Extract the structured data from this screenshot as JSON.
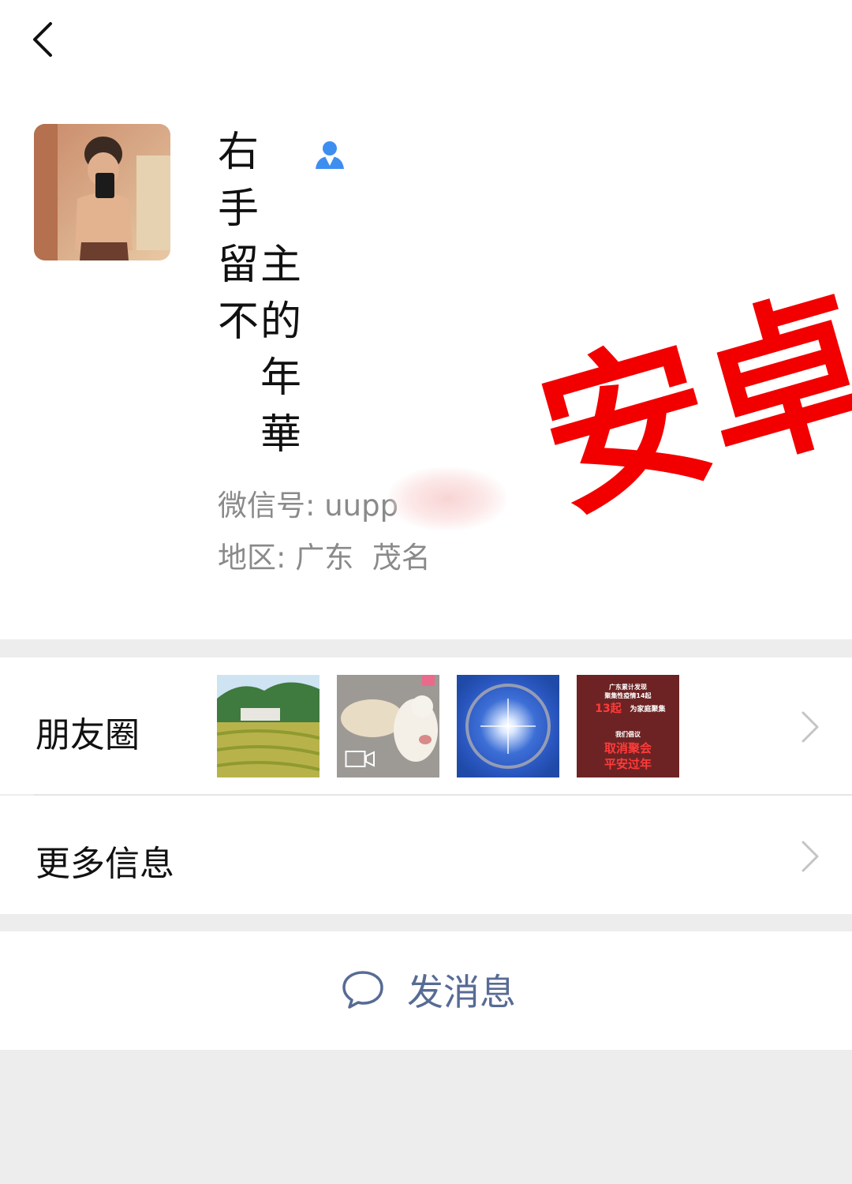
{
  "header": {
    "back_icon": "chevron-left-icon"
  },
  "profile": {
    "name_column_1": [
      "右",
      "手",
      "留",
      "不"
    ],
    "name_column_2": [
      "",
      "",
      "主",
      "的",
      "年",
      "華"
    ],
    "wechat_id_label": "微信号:",
    "wechat_id_value": "uupp",
    "region_label": "地区:",
    "region_value": "广东  茂名",
    "contact_icon": "person-icon"
  },
  "watermark": {
    "text": "安卓",
    "color": "#f20000"
  },
  "moments": {
    "label": "朋友圈",
    "thumbnails": [
      {
        "name": "rice-terrace-photo"
      },
      {
        "name": "dogs-video",
        "icon": "video-camera-icon"
      },
      {
        "name": "sun-halo-photo"
      },
      {
        "name": "epidemic-poster",
        "lines": [
          "广东累计发现",
          "聚集性疫情14起",
          "13起",
          "为家庭聚集",
          "我们倡议",
          "取消聚会",
          "平安过年"
        ]
      }
    ]
  },
  "more_info": {
    "label": "更多信息"
  },
  "actions": {
    "send_message_label": "发消息",
    "send_icon": "chat-bubble-icon"
  },
  "colors": {
    "link_blue": "#576b95",
    "gray_text": "#8a8a8a",
    "page_bg": "#ededed"
  }
}
